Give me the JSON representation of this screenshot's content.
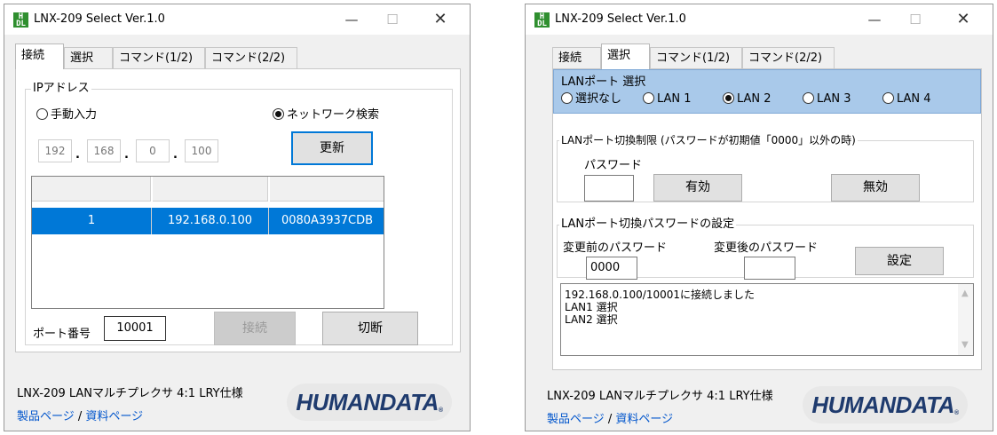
{
  "window_title": "LNX-209 Select Ver.1.0",
  "app_icon_text": "H\nDL",
  "controls": {
    "minimize": "—",
    "maximize": "☐",
    "close": "✕"
  },
  "tabs": [
    "接続",
    "選択",
    "コマンド(1/2)",
    "コマンド(2/2)"
  ],
  "connect_panel": {
    "group_label": "IPアドレス",
    "manual_label": "手動入力",
    "network_label": "ネットワーク検索",
    "selected_mode": "network",
    "ip": [
      "192",
      "168",
      "0",
      "100"
    ],
    "ip_sep": ".",
    "refresh_label": "更新",
    "list_row": {
      "num": "1",
      "ip": "192.168.0.100",
      "mac": "0080A3937CDB"
    },
    "port_label": "ポート番号",
    "port_value": "10001",
    "connect_label": "接続",
    "disconnect_label": "切断"
  },
  "select_panel": {
    "lan_group_label": "LANポート 選択",
    "lan_options": [
      "選択なし",
      "LAN 1",
      "LAN 2",
      "LAN 3",
      "LAN 4"
    ],
    "lan_selected": "LAN 2",
    "limit_group_label": "LANポート切換制限 (パスワードが初期値「0000」以外の時)",
    "password_label": "パスワード",
    "enable_label": "有効",
    "disable_label": "無効",
    "pw_group_label": "LANポート切換パスワードの設定",
    "old_pw_label": "変更前のパスワード",
    "new_pw_label": "変更後のパスワード",
    "old_pw_value": "0000",
    "set_label": "設定",
    "log": [
      "192.168.0.100/10001に接続しました",
      "LAN1 選択",
      "LAN2 選択"
    ]
  },
  "footer": {
    "product": "LNX-209  LANマルチプレクサ 4:1 LRY仕様",
    "link1": "製品ページ",
    "link_sep": "/",
    "link2": "資料ページ",
    "logo": "HUMANDATA",
    "logo_mark": "®"
  },
  "colors": {
    "selection": "#0078d7",
    "lan_group_bg": "#a9c9ea",
    "link": "#0055cc",
    "logo_text": "#1f3b6e"
  }
}
